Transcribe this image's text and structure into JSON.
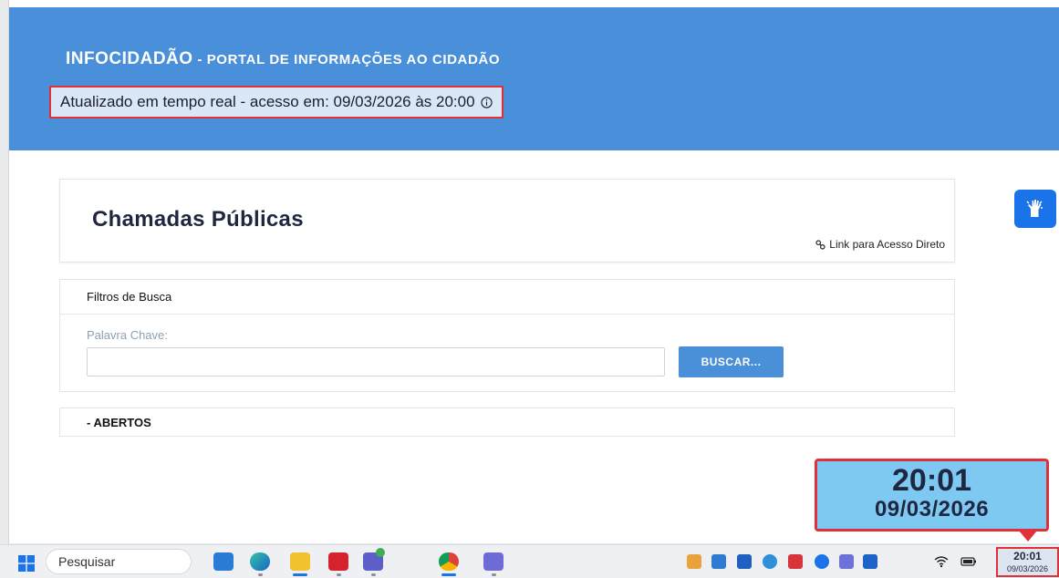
{
  "header": {
    "brand": "INFOCIDADÃO",
    "subtitle": " - PORTAL DE INFORMAÇÕES AO CIDADÃO",
    "updated": "Atualizado em tempo real - acesso em: 09/03/2026 às 20:00"
  },
  "page": {
    "title": "Chamadas Públicas",
    "direct_link": "Link para Acesso Direto"
  },
  "filters": {
    "heading": "Filtros de Busca",
    "keyword_label": "Palavra Chave:",
    "keyword_value": "",
    "search_button": "BUSCAR..."
  },
  "sections": {
    "open_label": "- ABERTOS"
  },
  "clock_callout": {
    "time": "20:01",
    "date": "09/03/2026"
  },
  "taskbar": {
    "search_placeholder": "Pesquisar",
    "clock_time": "20:01",
    "clock_date": "09/03/2026"
  },
  "icons": {
    "accessibility": "hand-sign-language-icon",
    "info": "info-circle-icon",
    "link": "link-icon",
    "start": "windows-start-icon"
  },
  "colors": {
    "header_blue": "#4a8fd9",
    "highlight_red": "#e0303a",
    "button_blue": "#4a90d9",
    "callout_blue": "#7ec9f2"
  }
}
